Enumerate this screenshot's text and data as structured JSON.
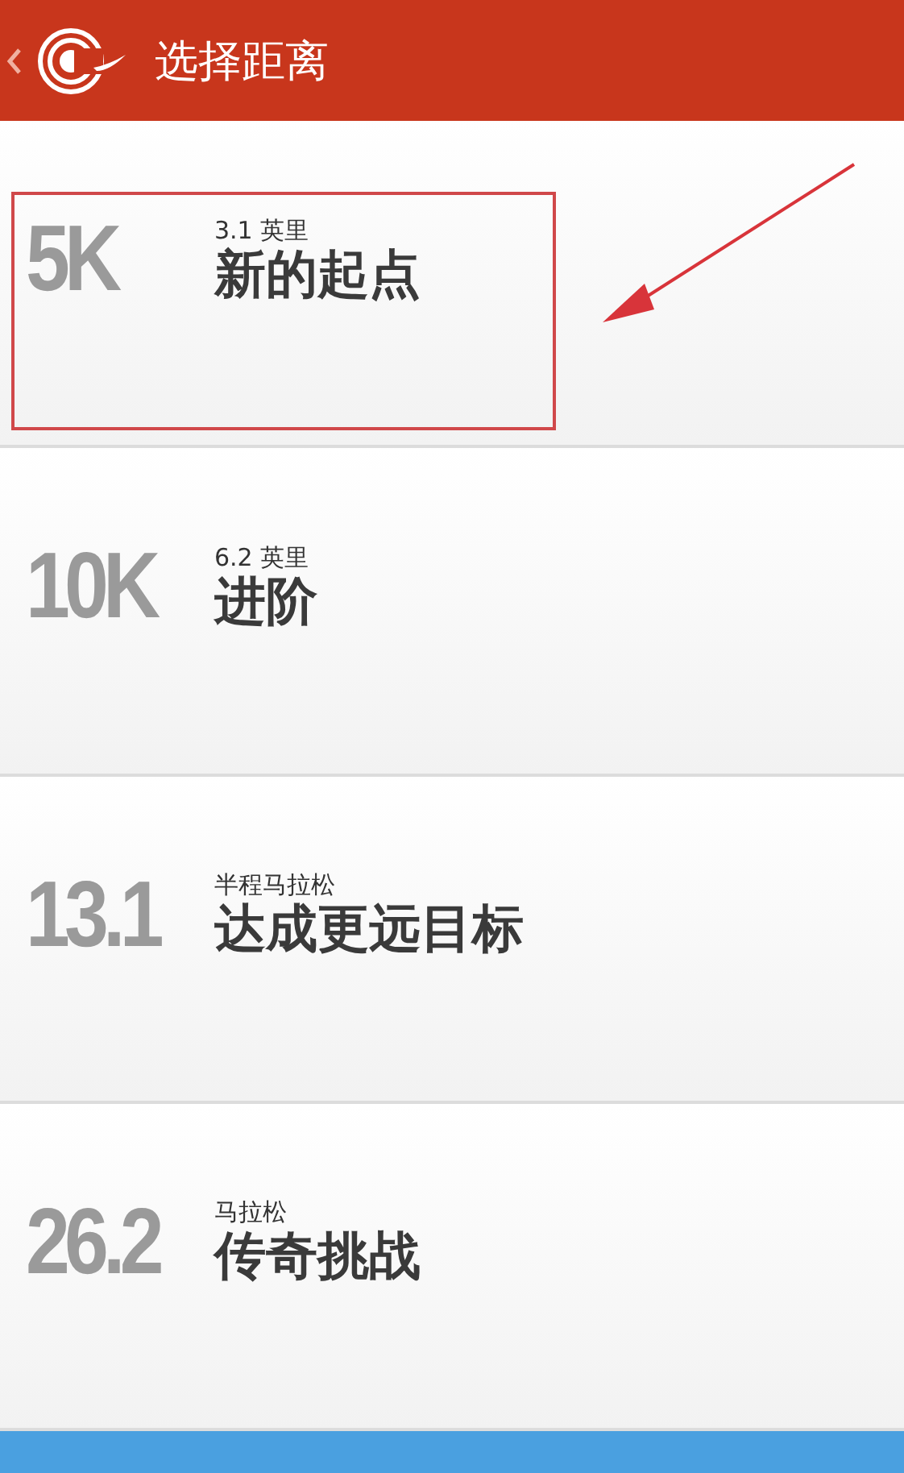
{
  "header": {
    "title": "选择距离"
  },
  "distances": [
    {
      "value": "5K",
      "subtitle": "3.1 英里",
      "title": "新的起点",
      "highlighted": true
    },
    {
      "value": "10K",
      "subtitle": "6.2 英里",
      "title": "进阶",
      "highlighted": false
    },
    {
      "value": "13.1",
      "subtitle": "半程马拉松",
      "title": "达成更远目标",
      "highlighted": false
    },
    {
      "value": "26.2",
      "subtitle": "马拉松",
      "title": "传奇挑战",
      "highlighted": false
    }
  ]
}
